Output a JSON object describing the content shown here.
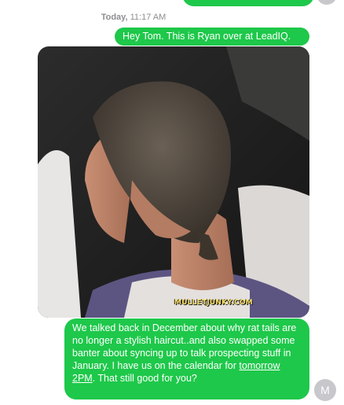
{
  "conversation": {
    "timestamp_day": "Today,",
    "timestamp_time": "11:17 AM",
    "messages": {
      "greeting": "Hey Tom. This is Ryan over at LeadIQ.",
      "photo_watermark": "MULLETJUNKY.COM",
      "body_part1": "We talked back in December about why rat tails are no longer a stylish haircut..and also swapped some banter about syncing up to talk prospecting stuff in January. I have us on the calendar for ",
      "body_link": "tomorrow 2PM",
      "body_part2": ". That still good for you?"
    },
    "sender_avatar_initial": "M"
  },
  "colors": {
    "bubble": "#1ec84a",
    "timestamp": "#8e8e93",
    "avatar": "#c7c7cc"
  }
}
